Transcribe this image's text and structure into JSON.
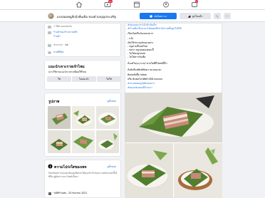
{
  "nav": {
    "notifications_badge": "9+",
    "menu_badge": "1"
  },
  "page": {
    "name": "แกงอ่อมหมูสับกุ้งหั่นเค็ม ของดำเลบุญประเสริฐ",
    "message_label": "ส่งข้อความ",
    "like_label": "ถูกใจแล้ว",
    "search_glyph": "🔍",
    "more_glyph": "···"
  },
  "about": {
    "rows": [
      {
        "icon": "star-icon",
        "text": "1 ให้คะแนนต่อวัน"
      },
      {
        "icon": "shop-icon",
        "text": "ร้านค้าของร้านขายปลีก",
        "link": true
      },
      {
        "icon": "shop-icon",
        "text": "ร้านค้า",
        "link": true
      },
      {
        "icon": "money-icon",
        "text": "ช่วงราคา · ฿฿"
      },
      {
        "icon": "info-icon",
        "text": "ขายดีที่สุด",
        "link": true
      }
    ]
  },
  "recommend": {
    "title": "แนะนำเจาะรายเจ้าไหม",
    "question": "เจาะใช้งานแนะนำเวลาเหมือนใช้ไหม",
    "buttons": [
      "ใช่",
      "ไม่แนะนำ",
      "ไม่ใช่"
    ]
  },
  "photos_card": {
    "title": "รูปภาพ",
    "see_all": "ดูทั้งหมด"
  },
  "reviews": {
    "title": "ความโปร่งใสของเพจ",
    "see_all": "ดูทั้งหมด",
    "text": "Facebook ช่วยแสดงข้อมูลเพื่อช่วยให้คุณเข้าใจวัตถุประสงค์ของเพจนี้ได้ดีขึ้น ดูผู้จัดการและโพสต์เนื้อหา",
    "created": "วันที่สร้างเพจ - 20 กันยายน 2021"
  },
  "post": {
    "lines": [
      {
        "text": "#ของเกมเก่าวันไปจำวุ้ยเด็ก",
        "link": true
      },
      {
        "text": "#ร้านเด็กเล็กอาหารน้อยยกอีกกำลังกายขั้นสูงใกล้ใช้",
        "link": true
      },
      {
        "text": "เรียบร้อยจีนนัดแมลงมาก"
      },
      {
        "text": "- แจ้ง"
      },
      {
        "text": "เปิดใช้ประชุมนักทุกอย่าง"
      },
      {
        "text": "- หมูสามชั้นสดใหม่"
      },
      {
        "text": "- หยาก หมูรอยดองตอนนี้"
      },
      {
        "text": "- ไม่ใส่ผงชูรสเลย"
      },
      {
        "text": "- ไม่ใส่สารกันเสีย"
      },
      {
        "text": "สั่งแค่ใน(๑) บาท/ ท่านใดที่มีโพสต์นี้จ้า"
      },
      {
        "text": "สั่งทันทีแค่พิมพ์ข้อความเลยนะคะ"
      },
      {
        "text": "ติดต่อสั่งซื้อ Inbox"
      },
      {
        "text": "หรือ ติดต่อโทรศัพท์ 088-xxxxxx"
      },
      {
        "text": "#แกงอ่อมหมูกุ้งส้มของเรา",
        "link": true
      },
      {
        "text": "#ของแซ่บของดีบ้านเรา",
        "link": true
      }
    ]
  }
}
